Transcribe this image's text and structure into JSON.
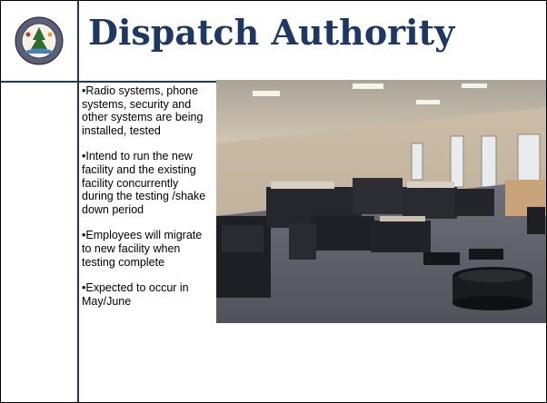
{
  "slide": {
    "title": "Dispatch Authority",
    "seal_text": "SEAL OF THE COUNTY OF OTTAWA MICHIGAN"
  },
  "bullets": [
    "•Radio systems, phone systems, security and other systems are being installed, tested",
    "•Intend to run the new facility and the existing facility concurrently during the testing /shake down period",
    "•Employees will migrate to new facility when testing complete",
    "•Expected to occur in May/June"
  ],
  "photo": {
    "subject": "dispatch-center-interior"
  },
  "colors": {
    "title": "#1f3763",
    "rule": "#1f3763"
  }
}
